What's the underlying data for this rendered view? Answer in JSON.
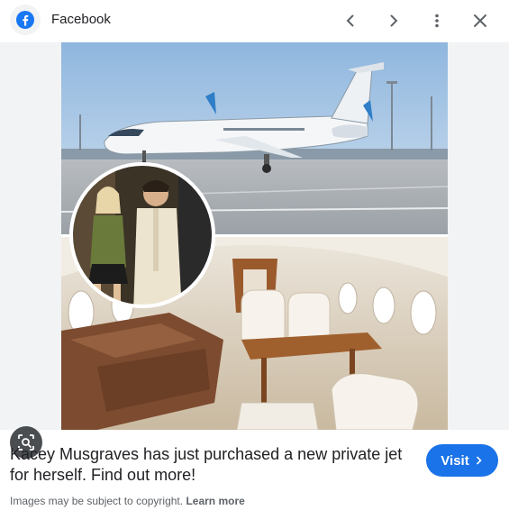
{
  "header": {
    "source_name": "Facebook",
    "icons": {
      "logo": "facebook-logo-icon",
      "prev": "chevron-left-icon",
      "next": "chevron-right-icon",
      "more": "more-vertical-icon",
      "close": "close-icon"
    }
  },
  "image": {
    "icons": {
      "lens": "lens-search-icon"
    }
  },
  "caption": {
    "headline": "Kacey Musgraves has just purchased a new private jet for herself. Find out more!",
    "visit_label": "Visit",
    "copyright_text": "Images may be subject to copyright.",
    "learn_more_label": "Learn more"
  },
  "colors": {
    "accent": "#1a73e8",
    "facebook_blue": "#1877f2",
    "text_primary": "#202124",
    "text_secondary": "#5f6368"
  }
}
